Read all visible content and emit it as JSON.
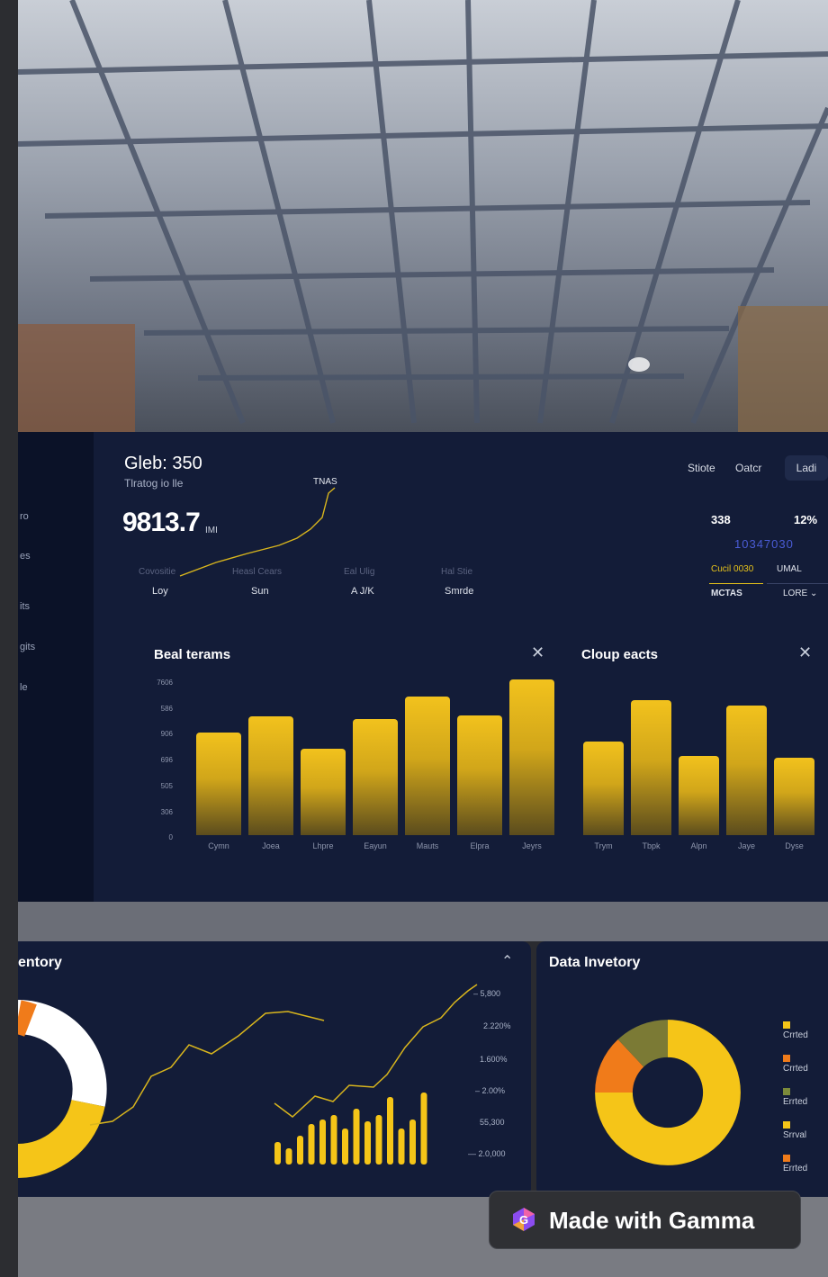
{
  "header": {
    "title": "Gleb: 350",
    "subtitle": "Tlratog io lle",
    "big_value": "9813.7",
    "big_unit": "IMI",
    "peak_label": "TNAS"
  },
  "sidebar": {
    "items": [
      "ro",
      "es",
      "its",
      "gits",
      "le"
    ]
  },
  "stats": [
    {
      "label": "Covositie",
      "value": "Loy"
    },
    {
      "label": "Heasl Cears",
      "value": "Sun"
    },
    {
      "label": "Eal Ulig",
      "value": "A J/K"
    },
    {
      "label": "Hal Stie",
      "value": "Smrde"
    }
  ],
  "top_links": [
    "Stiote",
    "Oatcr"
  ],
  "top_button": "Ladi",
  "kpis": {
    "value_a": "338",
    "value_b": "12%",
    "value_blue": "10347030",
    "tab_active": "Cucil 0030",
    "tab_other": "UMAL",
    "label_a": "MCTAS",
    "label_b": "LORE",
    "dropdown_icon": "chevron-down-icon"
  },
  "card_left": {
    "title": "Beal terams",
    "y_ticks": [
      "7606",
      "586",
      "906",
      "696",
      "505",
      "306",
      "0"
    ],
    "categories": [
      "Cymn",
      "Joea",
      "Lhpre",
      "Eayun",
      "Mauts",
      "Elpra",
      "Jeyrs"
    ],
    "values": [
      612,
      705,
      512,
      688,
      825,
      710,
      925
    ]
  },
  "card_right": {
    "title": "Cloup eacts",
    "categories": [
      "Trym",
      "Tbpk",
      "Alpn",
      "Jaye",
      "Dyse"
    ],
    "values": [
      565,
      815,
      480,
      785,
      465
    ]
  },
  "panel_left": {
    "title": "entory",
    "right_ticks": [
      "– 5,800",
      "2.220%",
      "1.600%",
      "– 2.00%",
      "55,300",
      "— 2.0,000"
    ]
  },
  "panel_right": {
    "title": "Data Invetory",
    "legend": [
      {
        "label": "Crrted",
        "color": "#f5c518"
      },
      {
        "label": "Crrted",
        "color": "#f07b1a"
      },
      {
        "label": "Errted",
        "color": "#7b8a3a"
      },
      {
        "label": "Srrval",
        "color": "#f5c518"
      },
      {
        "label": "Errted",
        "color": "#f07b1a"
      }
    ]
  },
  "badge": {
    "text": "Made with Gamma"
  },
  "chart_data": [
    {
      "type": "bar",
      "title": "Beal terams",
      "categories": [
        "Cymn",
        "Joea",
        "Lhpre",
        "Eayun",
        "Mauts",
        "Elpra",
        "Jeyrs"
      ],
      "values": [
        612,
        705,
        512,
        688,
        825,
        710,
        925
      ]
    },
    {
      "type": "bar",
      "title": "Cloup eacts",
      "categories": [
        "Trym",
        "Tbpk",
        "Alpn",
        "Jaye",
        "Dyse"
      ],
      "values": [
        565,
        815,
        480,
        785,
        465
      ]
    },
    {
      "type": "pie",
      "title": "Data Invetory",
      "categories": [
        "Crrted",
        "Crrted",
        "Errted"
      ],
      "values": [
        75,
        13,
        12
      ]
    }
  ]
}
